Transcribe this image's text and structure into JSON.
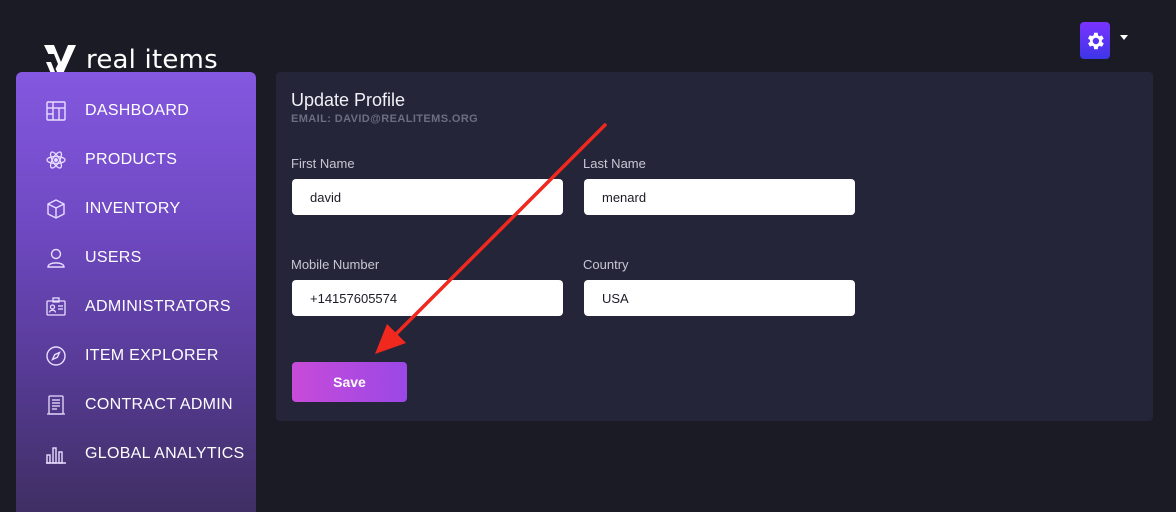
{
  "brand": {
    "name": "real items",
    "logo_icon": "real-items-logo"
  },
  "header": {
    "settings_icon": "gear-icon",
    "accent": "#7a33ff"
  },
  "sidebar": {
    "items": [
      {
        "label": "DASHBOARD",
        "icon": "dashboard-icon"
      },
      {
        "label": "PRODUCTS",
        "icon": "atom-icon"
      },
      {
        "label": "INVENTORY",
        "icon": "box-icon"
      },
      {
        "label": "USERS",
        "icon": "user-icon"
      },
      {
        "label": "ADMINISTRATORS",
        "icon": "id-card-icon"
      },
      {
        "label": "ITEM EXPLORER",
        "icon": "compass-icon"
      },
      {
        "label": "CONTRACT ADMIN",
        "icon": "document-icon"
      },
      {
        "label": "GLOBAL ANALYTICS",
        "icon": "bar-chart-icon"
      }
    ]
  },
  "form": {
    "title": "Update Profile",
    "email_line": "EMAIL: DAVID@REALITEMS.ORG",
    "first_name": {
      "label": "First Name",
      "value": "david"
    },
    "last_name": {
      "label": "Last Name",
      "value": "menard"
    },
    "mobile": {
      "label": "Mobile Number",
      "value": "+14157605574"
    },
    "country": {
      "label": "Country",
      "value": "USA"
    },
    "save_label": "Save"
  },
  "annotation": {
    "type": "red-arrow",
    "color": "#f0281e",
    "points_to": "save-button"
  }
}
